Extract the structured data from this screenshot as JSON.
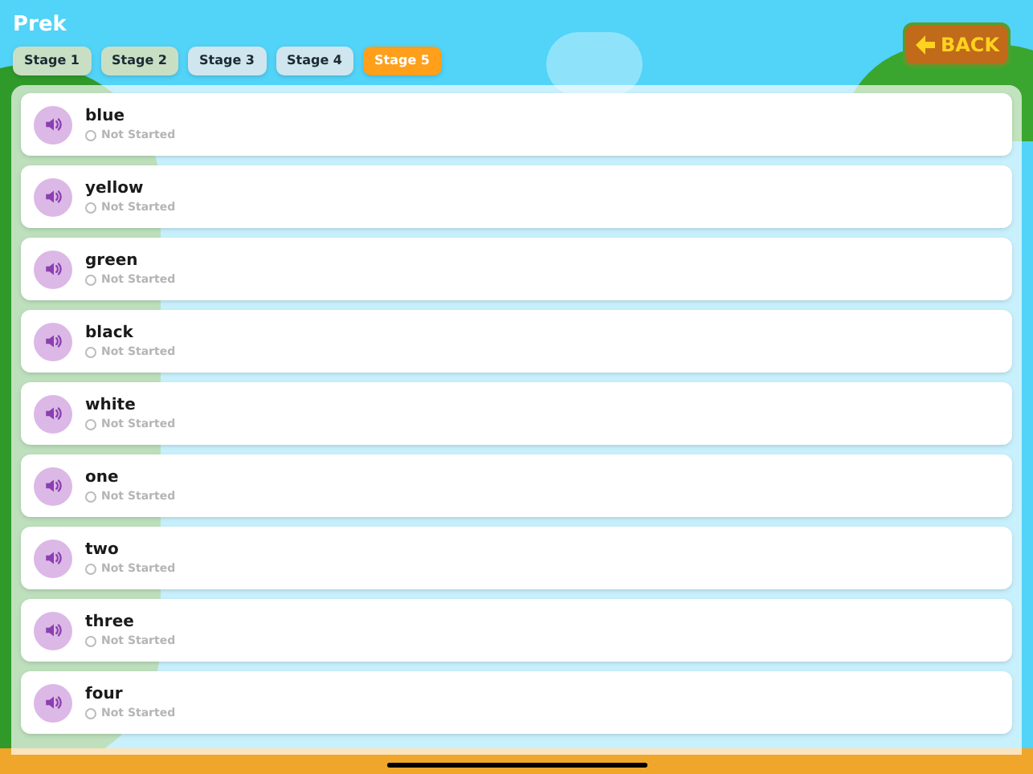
{
  "title": "Prek",
  "back_button": {
    "label": "BACK"
  },
  "tabs": [
    {
      "label": "Stage 1",
      "selected": false,
      "color": "#c9dfc4"
    },
    {
      "label": "Stage 2",
      "selected": false,
      "color": "#c9dfc4"
    },
    {
      "label": "Stage 3",
      "selected": false,
      "color": "#cfe6ee"
    },
    {
      "label": "Stage 4",
      "selected": false,
      "color": "#cfe6ee"
    },
    {
      "label": "Stage 5",
      "selected": true,
      "color": "#ff9f1a"
    }
  ],
  "words": [
    {
      "word": "blue",
      "status": "Not Started"
    },
    {
      "word": "yellow",
      "status": "Not Started"
    },
    {
      "word": "green",
      "status": "Not Started"
    },
    {
      "word": "black",
      "status": "Not Started"
    },
    {
      "word": "white",
      "status": "Not Started"
    },
    {
      "word": "one",
      "status": "Not Started"
    },
    {
      "word": "two",
      "status": "Not Started"
    },
    {
      "word": "three",
      "status": "Not Started"
    },
    {
      "word": "four",
      "status": "Not Started"
    }
  ]
}
